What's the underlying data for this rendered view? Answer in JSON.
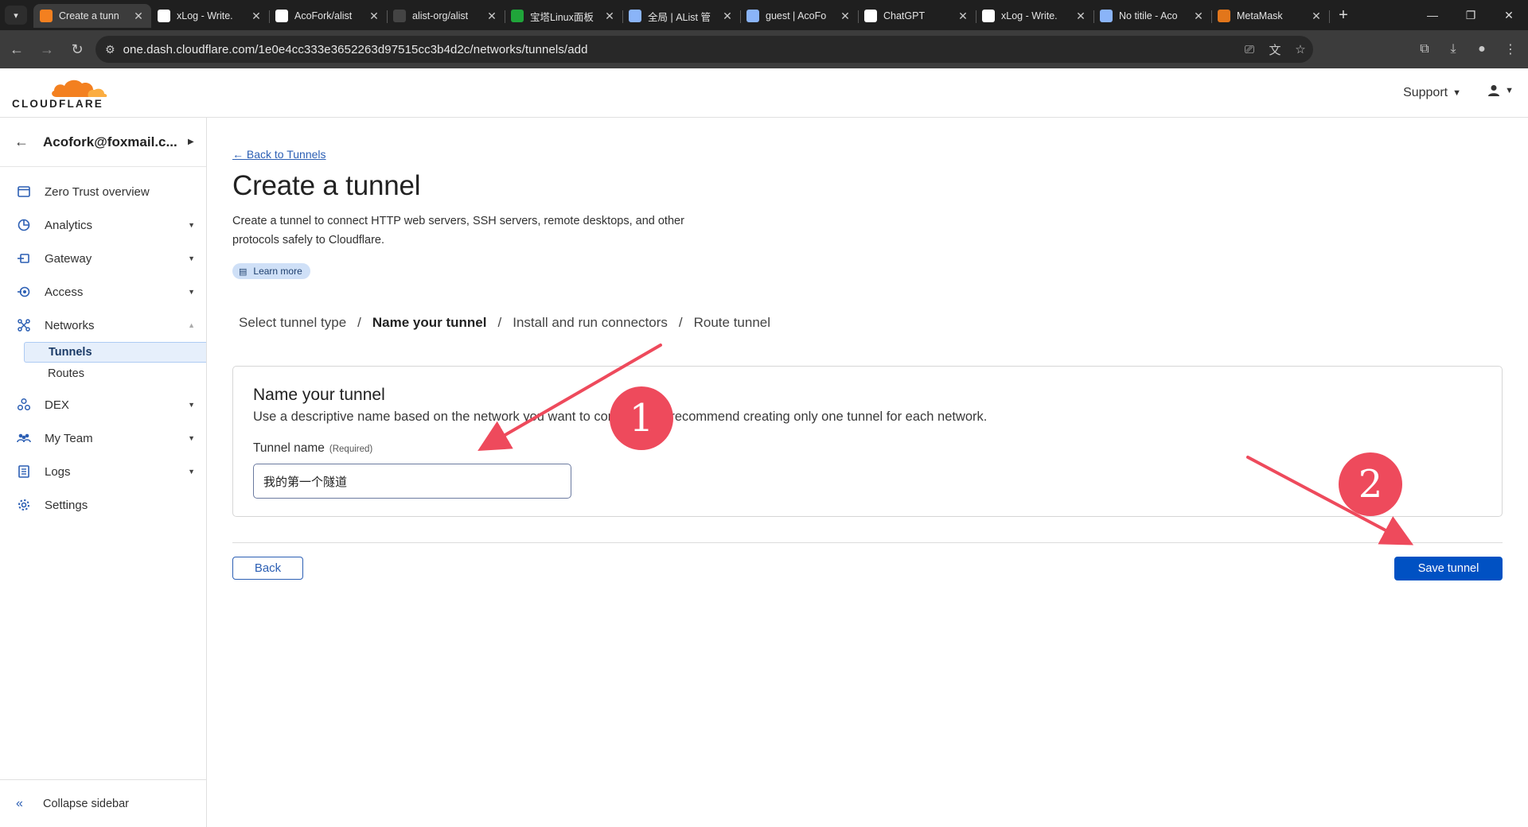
{
  "browser": {
    "tabs": [
      {
        "label": "Create a tunn",
        "fav": "cloudflare-favicon",
        "color": "#f38020",
        "active": true
      },
      {
        "label": "xLog - Write.",
        "fav": "xlog-favicon",
        "color": "#ffffff",
        "active": false
      },
      {
        "label": "AcoFork/alist",
        "fav": "github-favicon",
        "color": "#ffffff",
        "active": false
      },
      {
        "label": "alist-org/alist",
        "fav": "github-favicon",
        "color": "#444444",
        "active": false
      },
      {
        "label": "宝塔Linux面板",
        "fav": "bt-favicon",
        "color": "#20a53a",
        "active": false
      },
      {
        "label": "全局 | AList 管",
        "fav": "alist-favicon",
        "color": "#8ab4f8",
        "active": false
      },
      {
        "label": "guest | AcoFo",
        "fav": "alist-favicon",
        "color": "#8ab4f8",
        "active": false
      },
      {
        "label": "ChatGPT",
        "fav": "chatgpt-favicon",
        "color": "#ffffff",
        "active": false
      },
      {
        "label": "xLog - Write.",
        "fav": "xlog-favicon",
        "color": "#ffffff",
        "active": false
      },
      {
        "label": "No titile - Aco",
        "fav": "alist-favicon",
        "color": "#8ab4f8",
        "active": false
      },
      {
        "label": "MetaMask",
        "fav": "metamask-favicon",
        "color": "#e2761b",
        "active": false
      }
    ],
    "url": "one.dash.cloudflare.com/1e0e4cc333e3652263d97515cc3b4d2c/networks/tunnels/add"
  },
  "header": {
    "logo_text": "CLOUDFLARE",
    "support_label": "Support"
  },
  "sidebar": {
    "account": "Acofork@foxmail.c...",
    "items": [
      {
        "label": "Zero Trust overview",
        "icon": "browser-window-icon",
        "caret": false
      },
      {
        "label": "Analytics",
        "icon": "pie-chart-icon",
        "caret": true
      },
      {
        "label": "Gateway",
        "icon": "gateway-icon",
        "caret": true
      },
      {
        "label": "Access",
        "icon": "access-icon",
        "caret": true
      },
      {
        "label": "Networks",
        "icon": "network-icon",
        "caret": true,
        "expanded": true
      }
    ],
    "subitems": [
      {
        "label": "Tunnels",
        "active": true
      },
      {
        "label": "Routes",
        "active": false
      }
    ],
    "items_after": [
      {
        "label": "DEX",
        "icon": "dex-icon",
        "caret": true
      },
      {
        "label": "My Team",
        "icon": "team-icon",
        "caret": true
      },
      {
        "label": "Logs",
        "icon": "logs-icon",
        "caret": true
      },
      {
        "label": "Settings",
        "icon": "gear-icon",
        "caret": false
      }
    ],
    "collapse_label": "Collapse sidebar"
  },
  "main": {
    "back_link": "← Back to Tunnels",
    "title": "Create a tunnel",
    "description": "Create a tunnel to connect HTTP web servers, SSH servers, remote desktops, and other protocols safely to Cloudflare.",
    "learn_more": "Learn more",
    "steps": [
      "Select tunnel type",
      "Name your tunnel",
      "Install and run connectors",
      "Route tunnel"
    ],
    "current_step": 1,
    "card": {
      "title": "Name your tunnel",
      "description": "Use a descriptive name based on the network you want to connect. We recommend creating only one tunnel for each network.",
      "field_label": "Tunnel name",
      "field_required": "(Required)",
      "field_value": "我的第一个隧道"
    },
    "back_button": "Back",
    "save_button": "Save tunnel"
  },
  "annotations": {
    "badge1": "1",
    "badge2": "2",
    "arrow_color": "#ee4a5c"
  }
}
